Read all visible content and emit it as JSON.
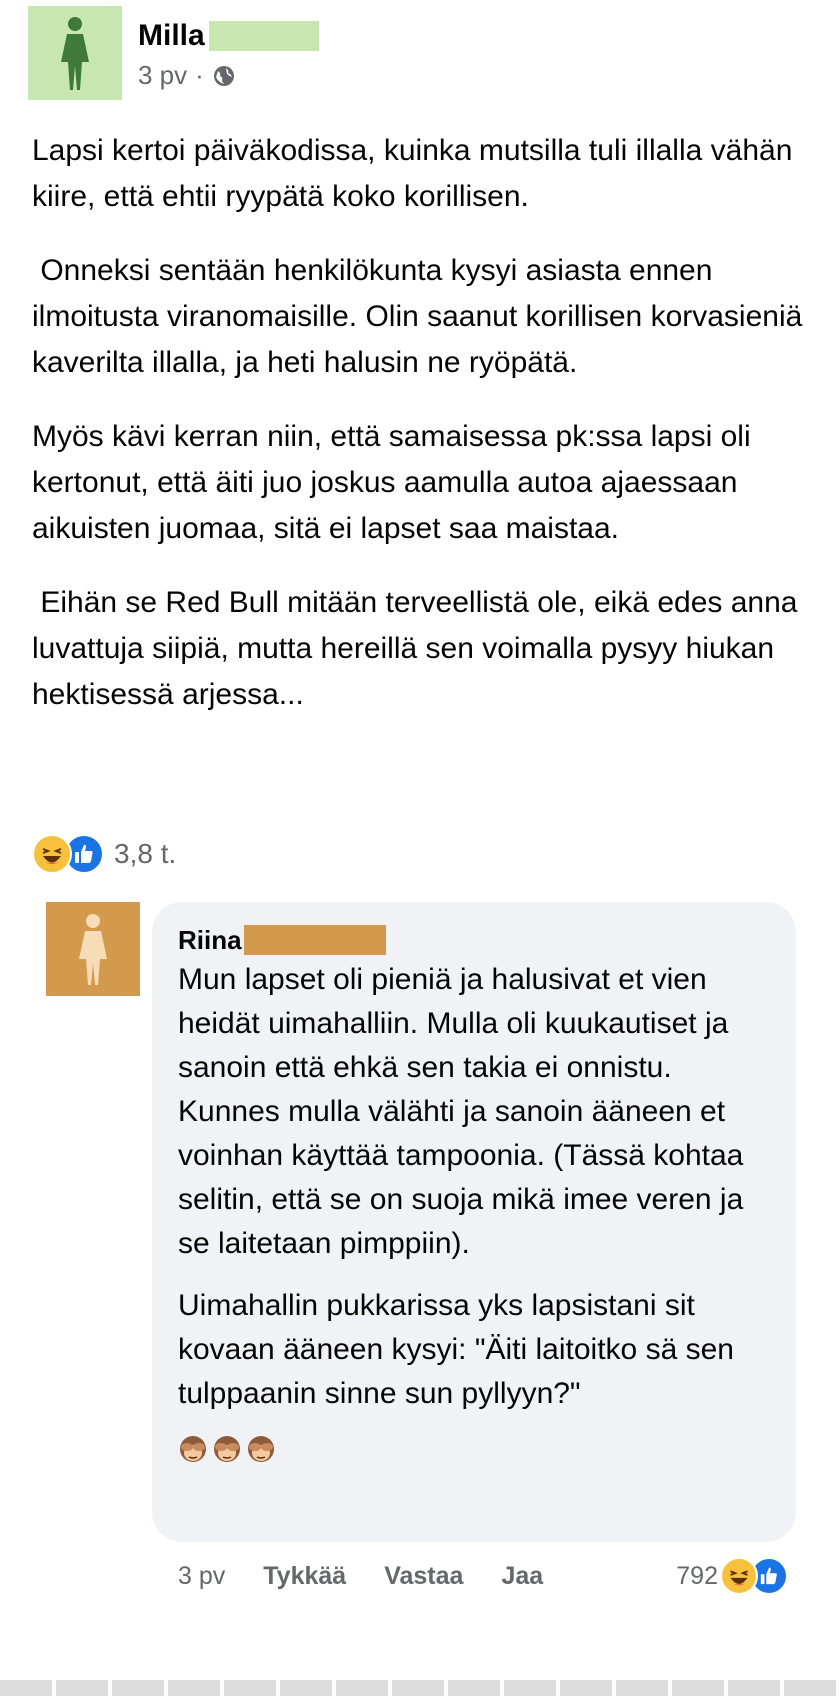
{
  "post": {
    "author": "Milla",
    "time": "3 pv",
    "separator": "·",
    "paragraphs": [
      "Lapsi kertoi päiväkodissa, kuinka mutsilla tuli illalla vähän kiire, että ehtii ryypätä koko korillisen.",
      " Onneksi sentään henkilökunta kysyi asiasta ennen ilmoitusta viranomaisille. Olin saanut korillisen korvasieniä kaverilta illalla, ja heti halusin ne ryöpätä.",
      "Myös kävi kerran niin, että samaisessa pk:ssa lapsi oli kertonut, että äiti juo joskus aamulla autoa ajaessaan aikuisten juomaa, sitä ei lapset saa maistaa.",
      " Eihän se Red Bull mitään terveellistä ole, eikä edes anna luvattuja siipiä, mutta hereillä sen voimalla pysyy hiukan hektisessä arjessa..."
    ],
    "reaction_count": "3,8 t."
  },
  "comment": {
    "author": "Riina",
    "paragraphs": [
      "Mun lapset oli pieniä ja halusivat et vien heidät uimahalliin. Mulla oli kuukautiset ja sanoin että ehkä sen takia ei onnistu. Kunnes mulla välähti ja sanoin ääneen et voinhan käyttää tampoonia. (Tässä kohtaa selitin, että se on suoja mikä imee veren ja se laitetaan pimppiin).",
      "Uimahallin pukkarissa yks lapsistani sit kovaan ääneen kysyi: \"Äiti laitoitko sä sen tulppaanin sinne sun pyllyyn?\""
    ],
    "time": "3 pv",
    "like_label": "Tykkää",
    "reply_label": "Vastaa",
    "share_label": "Jaa",
    "reaction_count": "792"
  },
  "colors": {
    "post_avatar_bg": "#c8e6b0",
    "comment_avatar_bg": "#d39a4e",
    "like_blue": "#1b74e4",
    "haha_yellow": "#f7c13b",
    "muted_text": "#65676b",
    "bubble_bg": "#f0f2f5"
  }
}
